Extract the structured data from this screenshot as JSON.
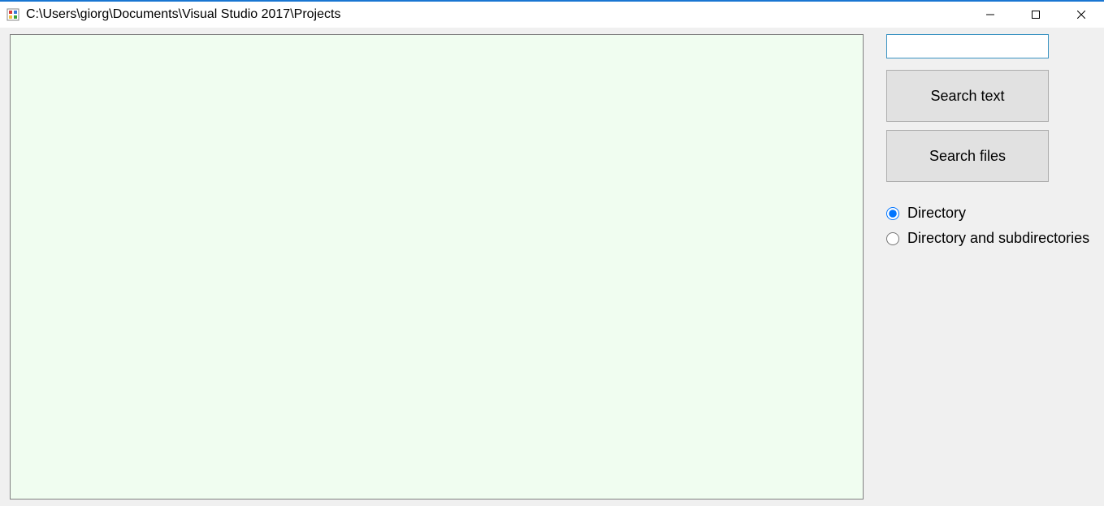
{
  "window": {
    "title": "C:\\Users\\giorg\\Documents\\Visual Studio 2017\\Projects"
  },
  "side": {
    "search_value": "",
    "search_placeholder": "",
    "search_text_label": "Search text",
    "search_files_label": "Search files",
    "radio_directory_label": "Directory",
    "radio_subdirs_label": "Directory and subdirectories",
    "radio_selected": "directory"
  },
  "colors": {
    "results_bg": "#f0fdf0",
    "button_bg": "#e1e1e1",
    "input_border": "#3a93c2"
  }
}
